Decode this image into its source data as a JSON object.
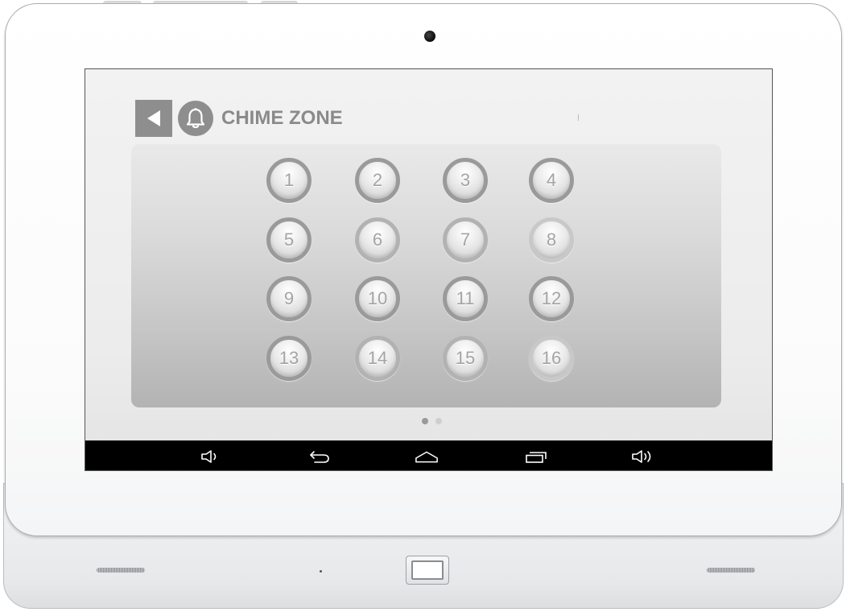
{
  "screen": {
    "title": "CHIME ZONE",
    "back_icon": "back-triangle-icon",
    "header_icon": "bell-icon"
  },
  "zones": [
    "1",
    "2",
    "3",
    "4",
    "5",
    "6",
    "7",
    "8",
    "9",
    "10",
    "11",
    "12",
    "13",
    "14",
    "15",
    "16"
  ],
  "pager": {
    "pages": 2,
    "current": 1
  },
  "navbar": {
    "items": [
      {
        "icon": "volume-down-icon"
      },
      {
        "icon": "back-arrow-icon"
      },
      {
        "icon": "home-icon"
      },
      {
        "icon": "recent-apps-icon"
      },
      {
        "icon": "volume-up-icon"
      }
    ]
  },
  "colors": {
    "navbar_bg": "#000000",
    "panel_top": "#e9e9e9",
    "panel_bottom": "#b3b3b3",
    "header_gray": "#8e8e8e",
    "title_gray": "#8a8a8a"
  }
}
